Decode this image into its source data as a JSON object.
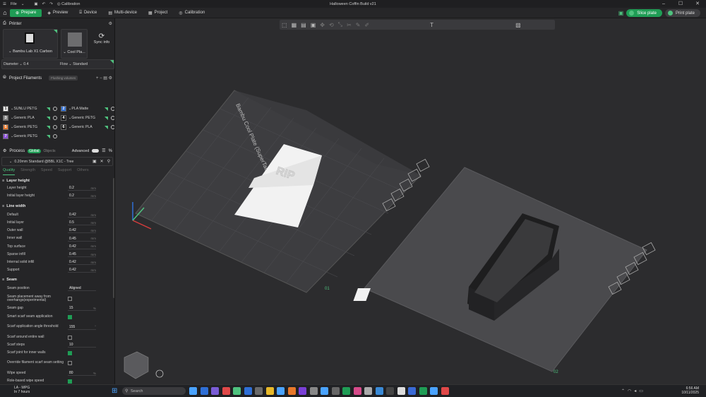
{
  "titlebar": {
    "file_menu": "File",
    "calibration_label": "Calibration",
    "title": "Halloween Coffin Build v21"
  },
  "tabs": [
    {
      "label": "Prepare",
      "icon": "prepare-icon"
    },
    {
      "label": "Preview",
      "icon": "preview-icon"
    },
    {
      "label": "Device",
      "icon": "device-icon"
    },
    {
      "label": "Multi-device",
      "icon": "multi-device-icon"
    },
    {
      "label": "Project",
      "icon": "project-icon"
    },
    {
      "label": "Calibration",
      "icon": "calibration-icon"
    }
  ],
  "actions": {
    "slice": "Slice plate",
    "print": "Print plate"
  },
  "printer": {
    "section_label": "Printer",
    "printer_name": "Bambu Lab X1 Carbon",
    "plate_name": "Cool Pla...",
    "sync_label": "Sync info",
    "diameter_label": "Diameter",
    "diameter_value": "0.4",
    "flow_label": "Flow",
    "flow_value": "Standard"
  },
  "filaments": {
    "section_label": "Project Filaments",
    "badge": "Flushing volumes",
    "items": [
      {
        "num": "1",
        "name": "SUNLU PETG",
        "color": "#f2f2f2",
        "numcolor": "#222"
      },
      {
        "num": "2",
        "name": "PLA Matte",
        "color": "#2f6fd6",
        "numcolor": "#fff"
      },
      {
        "num": "3",
        "name": "Generic PLA",
        "color": "#888888",
        "numcolor": "#fff"
      },
      {
        "num": "4",
        "name": "Generic PETG",
        "color": "#1a1a1a",
        "numcolor": "#fff"
      },
      {
        "num": "5",
        "name": "Generic PETG",
        "color": "#e8782a",
        "numcolor": "#fff"
      },
      {
        "num": "6",
        "name": "Generic PLA",
        "color": "#1a1a1a",
        "numcolor": "#fff"
      },
      {
        "num": "7",
        "name": "Generic PETG",
        "color": "#8a4fd6",
        "numcolor": "#fff"
      }
    ]
  },
  "process": {
    "section_label": "Process",
    "global": "Global",
    "objects": "Objects",
    "advanced": "Advanced",
    "preset": "0.20mm Standard @BBL X1C - Tree",
    "subtabs": [
      "Quality",
      "Strength",
      "Speed",
      "Support",
      "Others"
    ]
  },
  "settings": {
    "layer_height": {
      "title": "Layer height",
      "rows": [
        {
          "label": "Layer height",
          "value": "0.2",
          "unit": "mm"
        },
        {
          "label": "Initial layer height",
          "value": "0.2",
          "unit": "mm"
        }
      ]
    },
    "line_width": {
      "title": "Line width",
      "rows": [
        {
          "label": "Default",
          "value": "0.42",
          "unit": "mm"
        },
        {
          "label": "Initial layer",
          "value": "0.5",
          "unit": "mm"
        },
        {
          "label": "Outer wall",
          "value": "0.42",
          "unit": "mm"
        },
        {
          "label": "Inner wall",
          "value": "0.45",
          "unit": "mm"
        },
        {
          "label": "Top surface",
          "value": "0.42",
          "unit": "mm"
        },
        {
          "label": "Sparse infill",
          "value": "0.45",
          "unit": "mm"
        },
        {
          "label": "Internal solid infill",
          "value": "0.42",
          "unit": "mm"
        },
        {
          "label": "Support",
          "value": "0.42",
          "unit": "mm"
        }
      ]
    },
    "seam": {
      "title": "Seam",
      "position_label": "Seam position",
      "position_value": "Aligned",
      "away_label": "Seam placement away from overhangs(experimental)",
      "gap_label": "Seam gap",
      "gap_value": "15",
      "gap_unit": "%",
      "scarf_label": "Smart scarf seam application",
      "angle_label": "Scarf application angle threshold",
      "angle_value": "155",
      "angle_unit": "°",
      "around_label": "Scarf around entire wall",
      "steps_label": "Scarf steps",
      "steps_value": "10",
      "inner_label": "Scarf joint for inner walls",
      "override_label": "Override filament scarf seam setting",
      "wipe_label": "Wipe speed",
      "wipe_value": "80",
      "wipe_unit": "%",
      "role_label": "Role-based wipe speed"
    },
    "precision": {
      "title": "Precision",
      "closing_label": "Slice gap closing radius",
      "closing_value": "0.049",
      "closing_unit": "mm"
    }
  },
  "viewport": {
    "plate1_label": "Bambu Cool Plate (SuperTack)",
    "plate1_index": "01",
    "plate2_index": "02",
    "object_text": "RIP"
  },
  "taskbar": {
    "weather_line1": "LA - WPG",
    "weather_line2": "In 7 hours",
    "search_placeholder": "Search",
    "time": "6:56 AM",
    "date": "10/11/2025"
  }
}
